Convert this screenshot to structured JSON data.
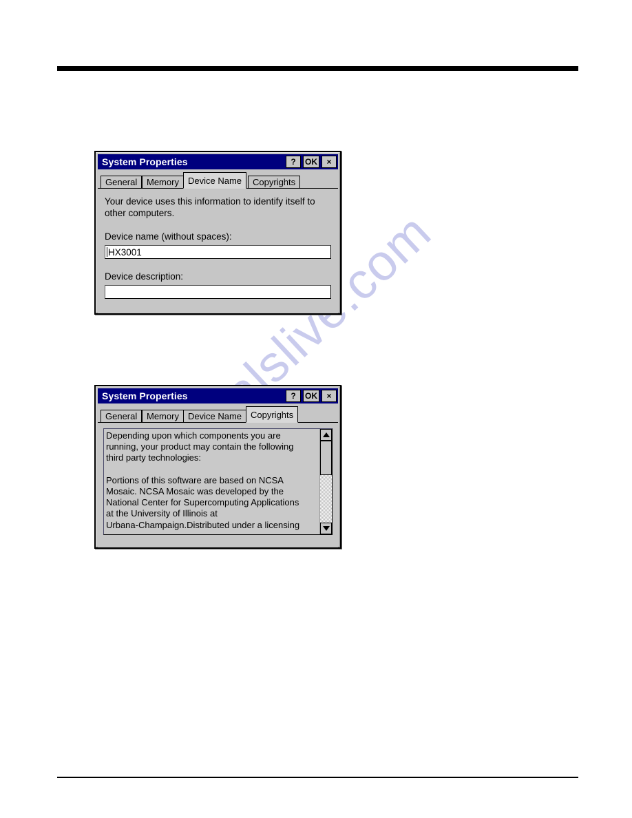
{
  "page": {
    "watermark_text": "manualslive.com",
    "rule_color": "#000000",
    "background": "#ffffff"
  },
  "dialogs": [
    {
      "id": "device-name-dialog",
      "title": "System Properties",
      "titlebar_color": "#00007e",
      "titlebar_buttons": [
        {
          "name": "help-button",
          "label": "?"
        },
        {
          "name": "ok-button",
          "label": "OK"
        },
        {
          "name": "close-button",
          "label": "×"
        }
      ],
      "tabs": [
        {
          "label": "General",
          "active": false
        },
        {
          "label": "Memory",
          "active": false
        },
        {
          "label": "Device Name",
          "active": true
        },
        {
          "label": "Copyrights",
          "active": false
        }
      ],
      "active_tab": "Device Name",
      "content": {
        "description": "Your device uses this information to identify itself to\nother computers.",
        "device_name_label": "Device name (without spaces):",
        "device_name_value": "HX3001",
        "device_description_label": "Device description:",
        "device_description_value": ""
      }
    },
    {
      "id": "copyrights-dialog",
      "title": "System Properties",
      "titlebar_color": "#00007e",
      "titlebar_buttons": [
        {
          "name": "help-button",
          "label": "?"
        },
        {
          "name": "ok-button",
          "label": "OK"
        },
        {
          "name": "close-button",
          "label": "×"
        }
      ],
      "tabs": [
        {
          "label": "General",
          "active": false
        },
        {
          "label": "Memory",
          "active": false
        },
        {
          "label": "Device Name",
          "active": false
        },
        {
          "label": "Copyrights",
          "active": true
        }
      ],
      "active_tab": "Copyrights",
      "content": {
        "copyright_text": "Depending upon which components you are\nrunning, your product may contain the following\nthird party technologies:\n\nPortions of this software are based on NCSA\nMosaic. NCSA Mosaic was developed by the\nNational Center for Supercomputing Applications\nat the University of Illinois at\nUrbana-Champaign.Distributed under a licensing",
        "scrollbar": {
          "up_arrow": "▲",
          "down_arrow": "▼",
          "thumb_position_percent": 0,
          "thumb_size_percent": 42
        }
      }
    }
  ]
}
